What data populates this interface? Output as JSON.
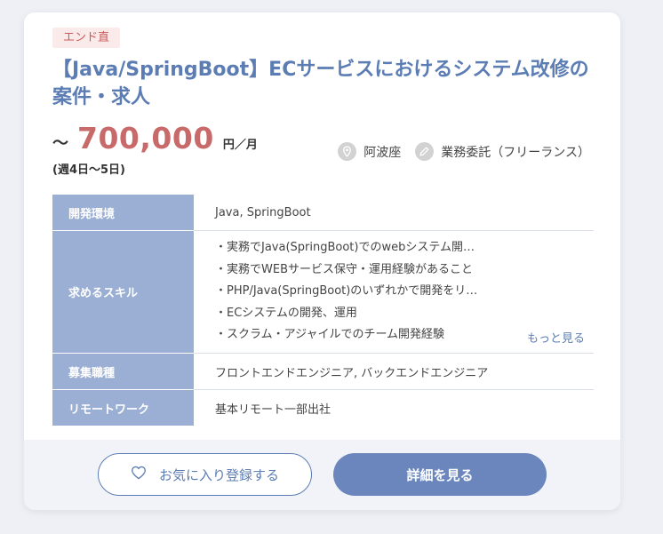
{
  "badge": "エンド直",
  "title": "【Java/SpringBoot】ECサービスにおけるシステム改修の案件・求人",
  "price": {
    "prefix": "〜",
    "amount": "700,000",
    "unit": "円／月",
    "days": "(週4日〜5日)"
  },
  "meta": {
    "location": "阿波座",
    "contract": "業務委託（フリーランス）"
  },
  "details": {
    "env_label": "開発環境",
    "env_value": "Java, SpringBoot",
    "skills_label": "求めるスキル",
    "skills": [
      "・実務でJava(SpringBoot)でのwebシステム開…",
      "・実務でWEBサービス保守・運用経験があること",
      "・PHP/Java(SpringBoot)のいずれかで開発をリ…",
      "・ECシステムの開発、運用",
      "・スクラム・アジャイルでのチーム開発経験"
    ],
    "more_label": "もっと見る",
    "role_label": "募集職種",
    "role_value": "フロントエンドエンジニア, バックエンドエンジニア",
    "remote_label": "リモートワーク",
    "remote_value": "基本リモート一部出社"
  },
  "buttons": {
    "favorite": "お気に入り登録する",
    "detail": "詳細を見る"
  },
  "icons": {
    "location": "map-pin-icon",
    "contract": "pencil-icon",
    "favorite": "heart-icon"
  },
  "colors": {
    "accent": "#5c7db3",
    "price": "#c86a6a",
    "table_header": "#9bafd4",
    "badge_bg": "#fbeaea",
    "badge_text": "#cc5b5b"
  }
}
